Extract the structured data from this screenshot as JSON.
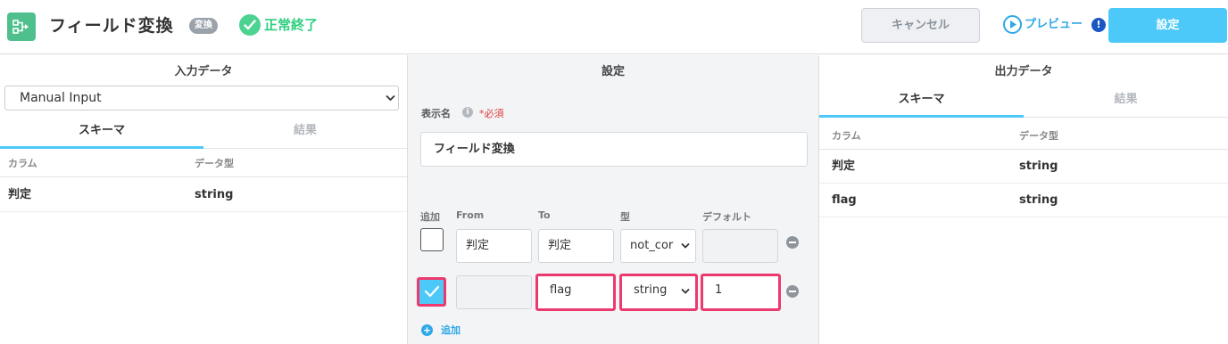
{
  "header": {
    "title": "フィールド変換",
    "badge": "変換",
    "status": "正常終了",
    "cancel_label": "キャンセル",
    "preview_label": "プレビュー",
    "preview_alert": "!",
    "save_label": "設定"
  },
  "input_panel": {
    "title": "入力データ",
    "source": "Manual Input",
    "tabs": [
      "スキーマ",
      "結果"
    ],
    "columns": [
      "カラム",
      "データ型"
    ],
    "rows": [
      {
        "column": "判定",
        "type": "string"
      }
    ]
  },
  "settings_panel": {
    "title": "設定",
    "display_name_label": "表示名",
    "info_glyph": "i",
    "required_label": "*必須",
    "display_name_value": "フィールド変換",
    "field_headers": {
      "add": "追加",
      "from": "From",
      "to": "To",
      "type": "型",
      "default": "デフォルト"
    },
    "fields": [
      {
        "checked": false,
        "from": "判定",
        "to": "判定",
        "type": "not_cor",
        "default": ""
      },
      {
        "checked": true,
        "from": "",
        "to": "flag",
        "type": "string",
        "default": "1"
      }
    ],
    "add_link": "追加"
  },
  "output_panel": {
    "title": "出力データ",
    "tabs": [
      "スキーマ",
      "結果"
    ],
    "columns": [
      "カラム",
      "データ型"
    ],
    "rows": [
      {
        "column": "判定",
        "type": "string"
      },
      {
        "column": "flag",
        "type": "string"
      }
    ]
  },
  "colors": {
    "accent": "#4cc9f8",
    "success": "#2ecf7f",
    "highlight": "#ec3a6e",
    "link": "#2ea8e6"
  }
}
